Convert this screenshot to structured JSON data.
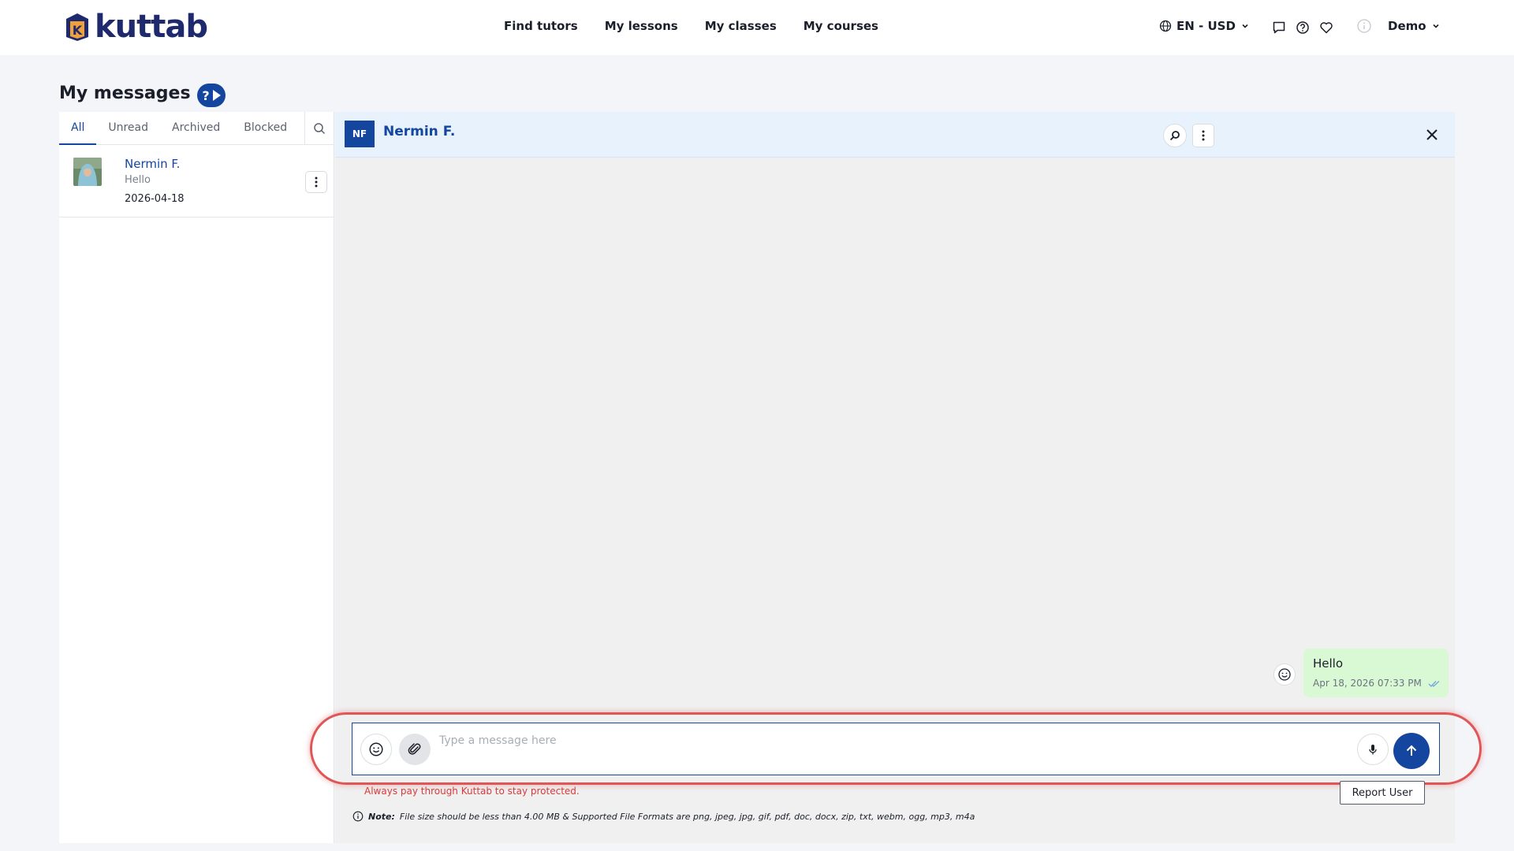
{
  "brand": {
    "name": "kuttab",
    "mark_letter": "K"
  },
  "nav": [
    {
      "label": "Find tutors"
    },
    {
      "label": "My lessons"
    },
    {
      "label": "My classes"
    },
    {
      "label": "My courses"
    }
  ],
  "header": {
    "locale": "EN - USD",
    "user_name": "Demo"
  },
  "page": {
    "title": "My messages",
    "help_glyph": "?"
  },
  "tabs": [
    {
      "label": "All",
      "active": true
    },
    {
      "label": "Unread"
    },
    {
      "label": "Archived"
    },
    {
      "label": "Blocked"
    }
  ],
  "conversations": [
    {
      "name": "Nermin F.",
      "preview": "Hello",
      "date": "2026-04-18"
    }
  ],
  "chat": {
    "initials": "NF",
    "contact_name": "Nermin F.",
    "messages": [
      {
        "text": "Hello",
        "time": "Apr 18, 2026 07:33 PM",
        "outgoing": true,
        "status": "read"
      }
    ],
    "composer_placeholder": "Type a message here",
    "warning": "Always pay through Kuttab to stay protected.",
    "report_label": "Report User",
    "note_label": "Note:",
    "note_text": "File size should be less than 4.00 MB & Supported File Formats are png, jpeg, jpg, gif, pdf, doc, docx, zip, txt, webm, ogg, mp3, m4a"
  },
  "colors": {
    "primary": "#1446a0",
    "highlight_ring": "#e05555",
    "bubble_outgoing": "#d9f8d4",
    "chat_header": "#e8f2fc",
    "warning": "#d83a3a"
  }
}
